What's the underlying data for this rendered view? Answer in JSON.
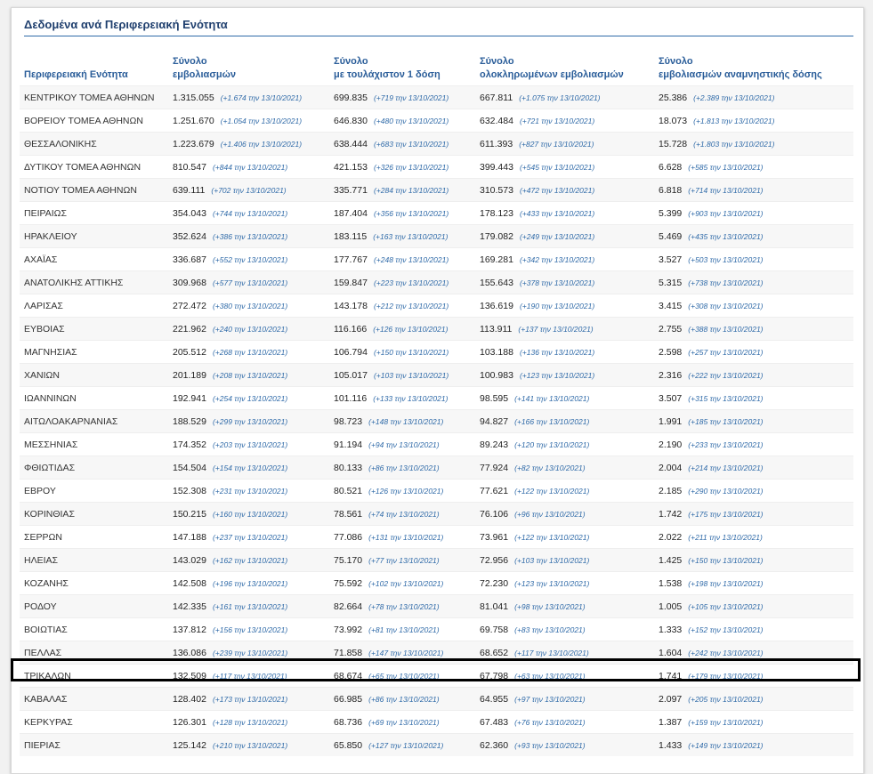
{
  "panel": {
    "title": "Δεδομένα ανά Περιφερειακή Ενότητα"
  },
  "table": {
    "headers": [
      "Περιφερειακή Ενότητα",
      "Σύνολο\nεμβολιασμών",
      "Σύνολο\nμε τουλάχιστον 1 δόση",
      "Σύνολο\nολοκληρωμένων εμβολιασμών",
      "Σύνολο\nεμβολιασμών αναμνηστικής δόσης"
    ],
    "highlighted_region": "ΤΡΙΚΑΛΩΝ",
    "rows": [
      [
        "ΚΕΝΤΡΙΚΟΥ ΤΟΜΕΑ ΑΘΗΝΩΝ",
        "1.315.055",
        "(+1.674 την 13/10/2021)",
        "699.835",
        "(+719 την 13/10/2021)",
        "667.811",
        "(+1.075 την 13/10/2021)",
        "25.386",
        "(+2.389 την 13/10/2021)"
      ],
      [
        "ΒΟΡΕΙΟΥ ΤΟΜΕΑ ΑΘΗΝΩΝ",
        "1.251.670",
        "(+1.054 την 13/10/2021)",
        "646.830",
        "(+480 την 13/10/2021)",
        "632.484",
        "(+721 την 13/10/2021)",
        "18.073",
        "(+1.813 την 13/10/2021)"
      ],
      [
        "ΘΕΣΣΑΛΟΝΙΚΗΣ",
        "1.223.679",
        "(+1.406 την 13/10/2021)",
        "638.444",
        "(+683 την 13/10/2021)",
        "611.393",
        "(+827 την 13/10/2021)",
        "15.728",
        "(+1.803 την 13/10/2021)"
      ],
      [
        "ΔΥΤΙΚΟΥ ΤΟΜΕΑ ΑΘΗΝΩΝ",
        "810.547",
        "(+844 την 13/10/2021)",
        "421.153",
        "(+326 την 13/10/2021)",
        "399.443",
        "(+545 την 13/10/2021)",
        "6.628",
        "(+585 την 13/10/2021)"
      ],
      [
        "ΝΟΤΙΟΥ ΤΟΜΕΑ ΑΘΗΝΩΝ",
        "639.111",
        "(+702 την 13/10/2021)",
        "335.771",
        "(+284 την 13/10/2021)",
        "310.573",
        "(+472 την 13/10/2021)",
        "6.818",
        "(+714 την 13/10/2021)"
      ],
      [
        "ΠΕΙΡΑΙΩΣ",
        "354.043",
        "(+744 την 13/10/2021)",
        "187.404",
        "(+356 την 13/10/2021)",
        "178.123",
        "(+433 την 13/10/2021)",
        "5.399",
        "(+903 την 13/10/2021)"
      ],
      [
        "ΗΡΑΚΛΕΙΟΥ",
        "352.624",
        "(+386 την 13/10/2021)",
        "183.115",
        "(+163 την 13/10/2021)",
        "179.082",
        "(+249 την 13/10/2021)",
        "5.469",
        "(+435 την 13/10/2021)"
      ],
      [
        "ΑΧΑΪΑΣ",
        "336.687",
        "(+552 την 13/10/2021)",
        "177.767",
        "(+248 την 13/10/2021)",
        "169.281",
        "(+342 την 13/10/2021)",
        "3.527",
        "(+503 την 13/10/2021)"
      ],
      [
        "ΑΝΑΤΟΛΙΚΗΣ ΑΤΤΙΚΗΣ",
        "309.968",
        "(+577 την 13/10/2021)",
        "159.847",
        "(+223 την 13/10/2021)",
        "155.643",
        "(+378 την 13/10/2021)",
        "5.315",
        "(+738 την 13/10/2021)"
      ],
      [
        "ΛΑΡΙΣΑΣ",
        "272.472",
        "(+380 την 13/10/2021)",
        "143.178",
        "(+212 την 13/10/2021)",
        "136.619",
        "(+190 την 13/10/2021)",
        "3.415",
        "(+308 την 13/10/2021)"
      ],
      [
        "ΕΥΒΟΙΑΣ",
        "221.962",
        "(+240 την 13/10/2021)",
        "116.166",
        "(+126 την 13/10/2021)",
        "113.911",
        "(+137 την 13/10/2021)",
        "2.755",
        "(+388 την 13/10/2021)"
      ],
      [
        "ΜΑΓΝΗΣΙΑΣ",
        "205.512",
        "(+268 την 13/10/2021)",
        "106.794",
        "(+150 την 13/10/2021)",
        "103.188",
        "(+136 την 13/10/2021)",
        "2.598",
        "(+257 την 13/10/2021)"
      ],
      [
        "ΧΑΝΙΩΝ",
        "201.189",
        "(+208 την 13/10/2021)",
        "105.017",
        "(+103 την 13/10/2021)",
        "100.983",
        "(+123 την 13/10/2021)",
        "2.316",
        "(+222 την 13/10/2021)"
      ],
      [
        "ΙΩΑΝΝΙΝΩΝ",
        "192.941",
        "(+254 την 13/10/2021)",
        "101.116",
        "(+133 την 13/10/2021)",
        "98.595",
        "(+141 την 13/10/2021)",
        "3.507",
        "(+315 την 13/10/2021)"
      ],
      [
        "ΑΙΤΩΛΟΑΚΑΡΝΑΝΙΑΣ",
        "188.529",
        "(+299 την 13/10/2021)",
        "98.723",
        "(+148 την 13/10/2021)",
        "94.827",
        "(+166 την 13/10/2021)",
        "1.991",
        "(+185 την 13/10/2021)"
      ],
      [
        "ΜΕΣΣΗΝΙΑΣ",
        "174.352",
        "(+203 την 13/10/2021)",
        "91.194",
        "(+94 την 13/10/2021)",
        "89.243",
        "(+120 την 13/10/2021)",
        "2.190",
        "(+233 την 13/10/2021)"
      ],
      [
        "ΦΘΙΩΤΙΔΑΣ",
        "154.504",
        "(+154 την 13/10/2021)",
        "80.133",
        "(+86 την 13/10/2021)",
        "77.924",
        "(+82 την 13/10/2021)",
        "2.004",
        "(+214 την 13/10/2021)"
      ],
      [
        "ΕΒΡΟΥ",
        "152.308",
        "(+231 την 13/10/2021)",
        "80.521",
        "(+126 την 13/10/2021)",
        "77.621",
        "(+122 την 13/10/2021)",
        "2.185",
        "(+290 την 13/10/2021)"
      ],
      [
        "ΚΟΡΙΝΘΙΑΣ",
        "150.215",
        "(+160 την 13/10/2021)",
        "78.561",
        "(+74 την 13/10/2021)",
        "76.106",
        "(+96 την 13/10/2021)",
        "1.742",
        "(+175 την 13/10/2021)"
      ],
      [
        "ΣΕΡΡΩΝ",
        "147.188",
        "(+237 την 13/10/2021)",
        "77.086",
        "(+131 την 13/10/2021)",
        "73.961",
        "(+122 την 13/10/2021)",
        "2.022",
        "(+211 την 13/10/2021)"
      ],
      [
        "ΗΛΕΙΑΣ",
        "143.029",
        "(+162 την 13/10/2021)",
        "75.170",
        "(+77 την 13/10/2021)",
        "72.956",
        "(+103 την 13/10/2021)",
        "1.425",
        "(+150 την 13/10/2021)"
      ],
      [
        "ΚΟΖΑΝΗΣ",
        "142.508",
        "(+196 την 13/10/2021)",
        "75.592",
        "(+102 την 13/10/2021)",
        "72.230",
        "(+123 την 13/10/2021)",
        "1.538",
        "(+198 την 13/10/2021)"
      ],
      [
        "ΡΟΔΟΥ",
        "142.335",
        "(+161 την 13/10/2021)",
        "82.664",
        "(+78 την 13/10/2021)",
        "81.041",
        "(+98 την 13/10/2021)",
        "1.005",
        "(+105 την 13/10/2021)"
      ],
      [
        "ΒΟΙΩΤΙΑΣ",
        "137.812",
        "(+156 την 13/10/2021)",
        "73.992",
        "(+81 την 13/10/2021)",
        "69.758",
        "(+83 την 13/10/2021)",
        "1.333",
        "(+152 την 13/10/2021)"
      ],
      [
        "ΠΕΛΛΑΣ",
        "136.086",
        "(+239 την 13/10/2021)",
        "71.858",
        "(+147 την 13/10/2021)",
        "68.652",
        "(+117 την 13/10/2021)",
        "1.604",
        "(+242 την 13/10/2021)"
      ],
      [
        "ΤΡΙΚΑΛΩΝ",
        "132.509",
        "(+117 την 13/10/2021)",
        "68.674",
        "(+65 την 13/10/2021)",
        "67.798",
        "(+63 την 13/10/2021)",
        "1.741",
        "(+179 την 13/10/2021)"
      ],
      [
        "ΚΑΒΑΛΑΣ",
        "128.402",
        "(+173 την 13/10/2021)",
        "66.985",
        "(+86 την 13/10/2021)",
        "64.955",
        "(+97 την 13/10/2021)",
        "2.097",
        "(+205 την 13/10/2021)"
      ],
      [
        "ΚΕΡΚΥΡΑΣ",
        "126.301",
        "(+128 την 13/10/2021)",
        "68.736",
        "(+69 την 13/10/2021)",
        "67.483",
        "(+76 την 13/10/2021)",
        "1.387",
        "(+159 την 13/10/2021)"
      ],
      [
        "ΠΙΕΡΙΑΣ",
        "125.142",
        "(+210 την 13/10/2021)",
        "65.850",
        "(+127 την 13/10/2021)",
        "62.360",
        "(+93 την 13/10/2021)",
        "1.433",
        "(+149 την 13/10/2021)"
      ]
    ]
  }
}
